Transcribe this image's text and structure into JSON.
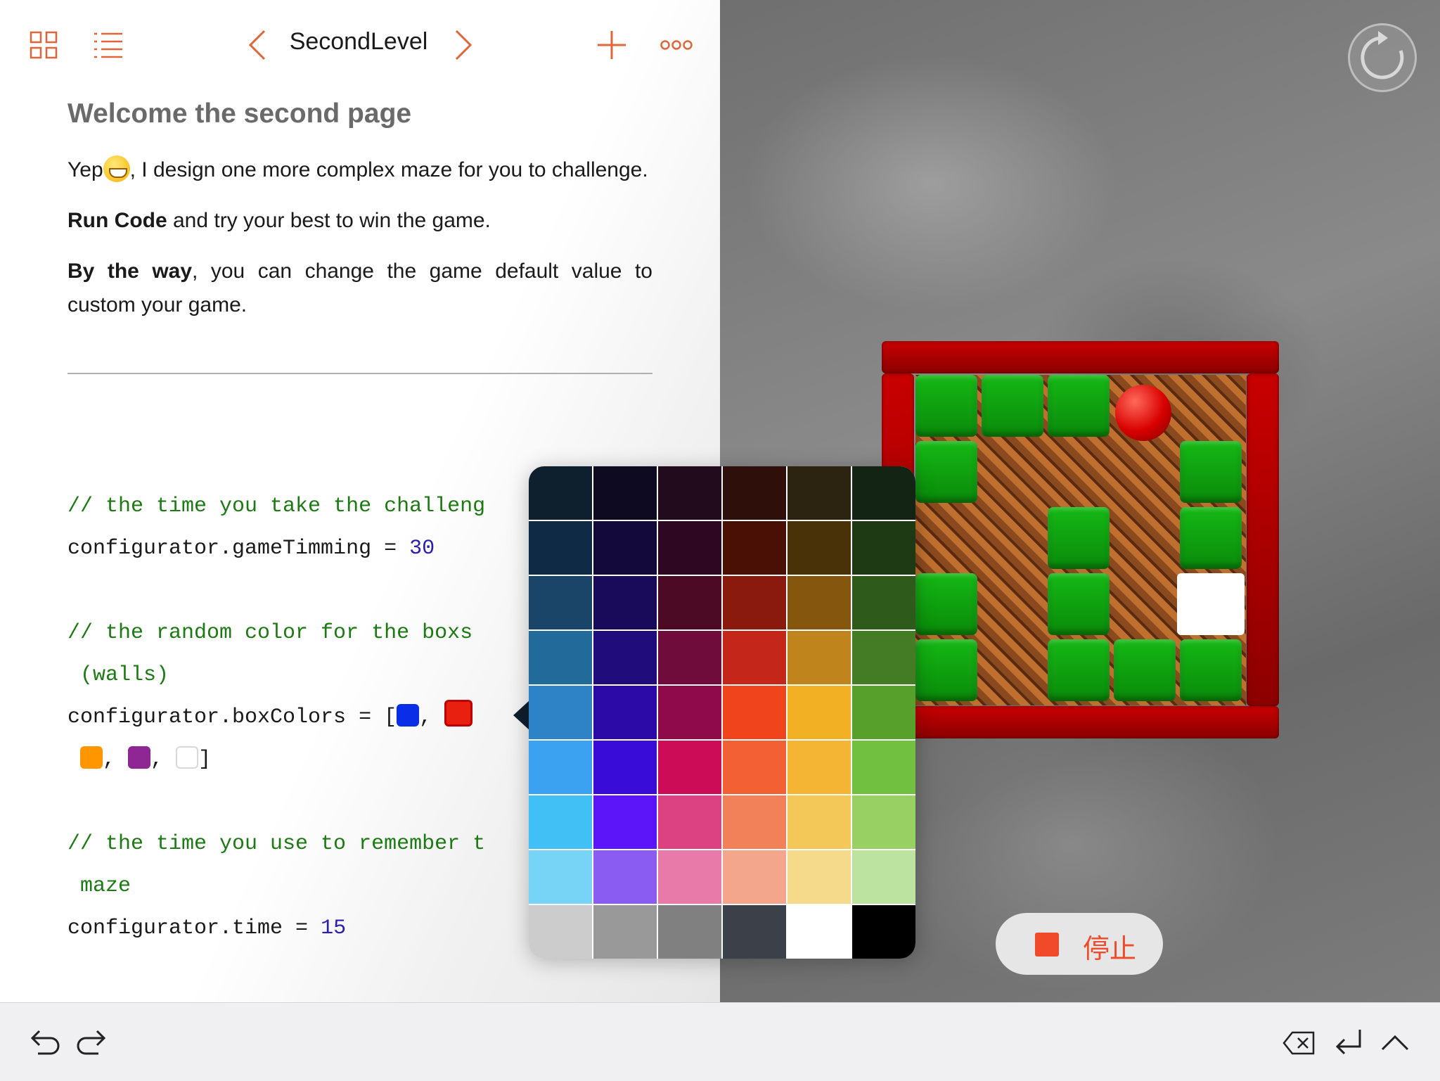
{
  "toolbar": {
    "nav_title": "SecondLevel",
    "icons": [
      "grid-icon",
      "list-icon",
      "chevron-left-icon",
      "chevron-right-icon",
      "plus-icon",
      "more-icon"
    ]
  },
  "doc": {
    "title": "Welcome the second page",
    "p1_a": "Yep",
    "p1_b": ", I design one more complex maze for you to challenge.",
    "p2_bold": "Run Code",
    "p2_rest": " and try your best to win the game.",
    "p3_bold": "By the way",
    "p3_rest": ", you can change the game default value to custom your game."
  },
  "code": {
    "c1": "// the time you take the challeng",
    "l2_prop": "configurator.gameTimming = ",
    "l2_val": "30",
    "c3": "// the random color for the boxs",
    "c3b": " (walls)",
    "l4_prop": "configurator.boxColors = [",
    "sep": ",",
    "close": "]",
    "box_colors": [
      "#0a2ee8",
      "#e8200f",
      "#ff9600",
      "#8e2694",
      "#ffffff"
    ],
    "c5": "// the time you use to remember t",
    "c5b": " maze",
    "l6_prop": "configurator.time = ",
    "l6_val": "15"
  },
  "picker": {
    "colors": [
      "#0e1f2e",
      "#0d0a22",
      "#220b1c",
      "#2e0f0a",
      "#2c2410",
      "#142414",
      "#0f2a44",
      "#14093b",
      "#2e0822",
      "#4a1006",
      "#4a3208",
      "#1e3a14",
      "#1a4568",
      "#1a0a5a",
      "#4c0a24",
      "#8a1a0e",
      "#84560e",
      "#2e5a1c",
      "#216a9a",
      "#200c7a",
      "#700c3c",
      "#c4261a",
      "#c0841c",
      "#447c26",
      "#2e82c6",
      "#2c0aa8",
      "#8e0a4a",
      "#f0441c",
      "#f2b024",
      "#58a02c",
      "#3aa2f0",
      "#3a0cd8",
      "#cc0c56",
      "#f26034",
      "#f4b434",
      "#72c040",
      "#40c0f4",
      "#5c14f8",
      "#dc4282",
      "#f28058",
      "#f4c858",
      "#98d064",
      "#78d4f6",
      "#8a5cf2",
      "#e87aaa",
      "#f4a68c",
      "#f6da8c",
      "#bce4a0",
      "#cccccc",
      "#999999",
      "#808080",
      "#3c4048",
      "#ffffff",
      "#000000"
    ]
  },
  "game": {
    "stop_label": "停止",
    "reset_icon": "reset-icon",
    "stop_color": "#f04a2a"
  },
  "bottombar": {
    "icons": [
      "undo-icon",
      "redo-icon",
      "delete-icon",
      "return-icon",
      "chevron-up-icon"
    ]
  }
}
